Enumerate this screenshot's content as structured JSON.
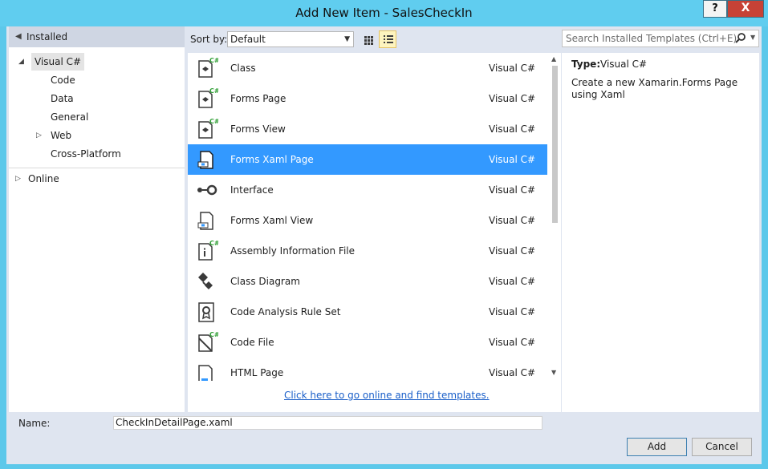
{
  "window": {
    "title": "Add New Item - SalesCheckIn",
    "help_label": "?",
    "close_label": "X"
  },
  "tree": {
    "header": "Installed",
    "items": [
      {
        "label": "Visual C#",
        "expander": "◢",
        "selected": true
      },
      {
        "label": "Code"
      },
      {
        "label": "Data"
      },
      {
        "label": "General"
      },
      {
        "label": "Web",
        "expander": "▷"
      },
      {
        "label": "Cross-Platform"
      }
    ],
    "online": "Online",
    "online_expander": "▷"
  },
  "toolbar": {
    "sort_label": "Sort by:",
    "sort_value": "Default"
  },
  "templates": [
    {
      "name": "Class",
      "lang": "Visual C#",
      "icon": "class-icon"
    },
    {
      "name": "Forms Page",
      "lang": "Visual C#",
      "icon": "forms-page-icon"
    },
    {
      "name": "Forms View",
      "lang": "Visual C#",
      "icon": "forms-view-icon"
    },
    {
      "name": "Forms Xaml Page",
      "lang": "Visual C#",
      "icon": "xaml-page-icon",
      "selected": true
    },
    {
      "name": "Interface",
      "lang": "Visual C#",
      "icon": "interface-icon"
    },
    {
      "name": "Forms Xaml View",
      "lang": "Visual C#",
      "icon": "xaml-view-icon"
    },
    {
      "name": "Assembly Information File",
      "lang": "Visual C#",
      "icon": "assembly-info-icon"
    },
    {
      "name": "Class Diagram",
      "lang": "Visual C#",
      "icon": "class-diagram-icon"
    },
    {
      "name": "Code Analysis Rule Set",
      "lang": "Visual C#",
      "icon": "rule-set-icon"
    },
    {
      "name": "Code File",
      "lang": "Visual C#",
      "icon": "code-file-icon"
    },
    {
      "name": "HTML Page",
      "lang": "Visual C#",
      "icon": "html-page-icon"
    }
  ],
  "online_link": "Click here to go online and find templates.",
  "search": {
    "placeholder": "Search Installed Templates (Ctrl+E)"
  },
  "details": {
    "type_label": "Type:",
    "type_value": "Visual C#",
    "description": "Create a new Xamarin.Forms Page using Xaml"
  },
  "footer": {
    "name_label": "Name:",
    "name_value": "CheckInDetailPage.xaml",
    "add_label": "Add",
    "cancel_label": "Cancel"
  },
  "colors": {
    "title_bar": "#60cdef",
    "selection": "#3399ff",
    "link": "#1a5fc9",
    "csharp_badge": "#2e9e33"
  }
}
